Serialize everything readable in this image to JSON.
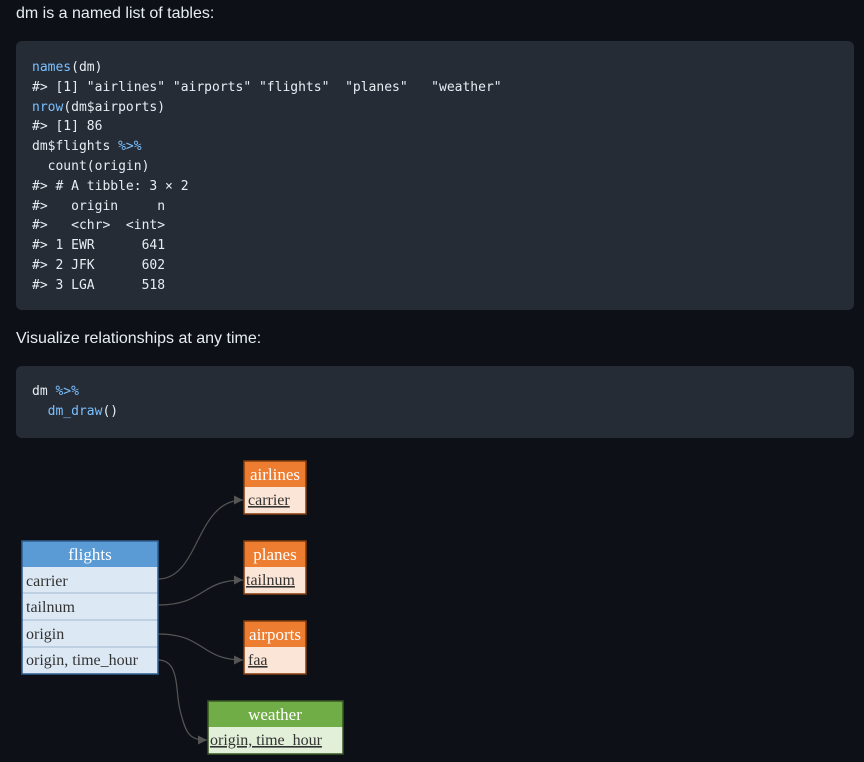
{
  "intro_text": "dm is a named list of tables:",
  "code1": {
    "lines": [
      [
        {
          "t": "names",
          "c": "fn"
        },
        {
          "t": "(dm)"
        }
      ],
      [
        {
          "t": "#> [1] \"airlines\" \"airports\" \"flights\"  \"planes\"   \"weather\""
        }
      ],
      [
        {
          "t": "nrow",
          "c": "fn"
        },
        {
          "t": "(dm$airports)"
        }
      ],
      [
        {
          "t": "#> [1] 86"
        }
      ],
      [
        {
          "t": "dm$flights "
        },
        {
          "t": "%>%",
          "c": "op"
        }
      ],
      [
        {
          "t": "  count(origin)"
        }
      ],
      [
        {
          "t": "#> # A tibble: 3 × 2"
        }
      ],
      [
        {
          "t": "#>   origin     n"
        }
      ],
      [
        {
          "t": "#>   <chr>  <int>"
        }
      ],
      [
        {
          "t": "#> 1 EWR      641"
        }
      ],
      [
        {
          "t": "#> 2 JFK      602"
        }
      ],
      [
        {
          "t": "#> 3 LGA      518"
        }
      ]
    ]
  },
  "visualize_text": "Visualize relationships at any time:",
  "code2": {
    "lines": [
      [
        {
          "t": "dm "
        },
        {
          "t": "%>%",
          "c": "op"
        }
      ],
      [
        {
          "t": "  "
        },
        {
          "t": "dm_draw",
          "c": "fn"
        },
        {
          "t": "()"
        }
      ]
    ]
  },
  "diagram": {
    "colors": {
      "flights_header": "#5b9bd5",
      "flights_body": "#dce9f5",
      "flights_border": "#2f5f8f",
      "orange_header": "#ed7d31",
      "orange_body": "#fbe5d6",
      "orange_border": "#843c0c",
      "green_header": "#70ad47",
      "green_body": "#e2efd9",
      "green_border": "#385723",
      "edge": "#555555"
    },
    "flights": {
      "title": "flights",
      "rows": [
        "carrier",
        "tailnum",
        "origin",
        "origin, time_hour"
      ]
    },
    "airlines": {
      "title": "airlines",
      "key": "carrier"
    },
    "planes": {
      "title": "planes",
      "key": "tailnum"
    },
    "airports": {
      "title": "airports",
      "key": "faa"
    },
    "weather": {
      "title": "weather",
      "key": "origin, time_hour"
    }
  }
}
